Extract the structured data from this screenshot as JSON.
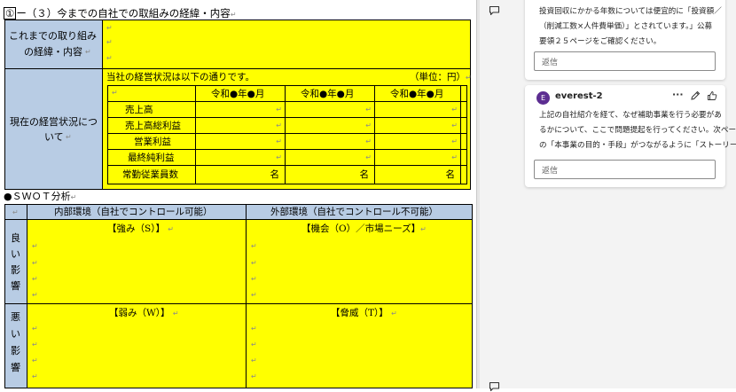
{
  "section_heading": {
    "prefix": "①",
    "text": "ー（３）今までの自社での取組みの経緯・内容"
  },
  "history": {
    "label_line1": "これまでの取り組み",
    "label_line2": "の経緯・内容"
  },
  "finance": {
    "label_line1": "現在の経営状況につ",
    "label_line2": "いて",
    "intro": "当社の経営状況は以下の通りです。",
    "unit": "（単位：円）",
    "period_headers": [
      "令和●年●月",
      "令和●年●月",
      "令和●年●月"
    ],
    "rows": [
      "売上高",
      "売上高総利益",
      "営業利益",
      "最終純利益",
      "常勤従業員数"
    ],
    "employee_unit": "名"
  },
  "swot": {
    "title": "●ＳＷＯＴ分析",
    "internal_header": "内部環境（自社でコントロール可能）",
    "external_header": "外部環境（自社でコントロール不可能）",
    "good_label": [
      "良",
      "い",
      "影",
      "響"
    ],
    "bad_label": [
      "悪",
      "い",
      "影",
      "響"
    ],
    "strength": "【強み（S）】",
    "opportunity": "【機会（O）／市場ニーズ】",
    "weakness": "【弱み（W）】",
    "threat": "【脅威（T）】"
  },
  "paragraph_mark": "↵",
  "comments": {
    "first": {
      "lines": [
        "投資回収にかかる年数については便宜的に「投資額／",
        "（削減工数×人件費単価）」とされています。」公募",
        "要領２５ページをご確認ください。"
      ],
      "reply_placeholder": "返信"
    },
    "second": {
      "avatar_letter": "E",
      "author": "everest-2",
      "more_glyph": "···",
      "lines": [
        "上記の自社紹介を経て、なぜ補助事業を行う必要があ",
        "るかについて、ここで問題提起を行ってください。次ページ",
        "の「本事業の目的・手段」がつながるように「ストーリー」"
      ],
      "reply_placeholder": "返信"
    }
  },
  "colors": {
    "highlight": "#ffff00",
    "label_blue": "#b8cce4",
    "avatar": "#5c2d91"
  }
}
